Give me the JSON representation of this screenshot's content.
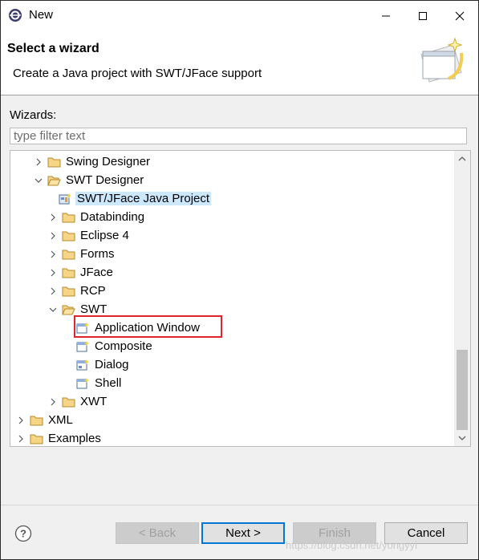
{
  "window": {
    "title": "New"
  },
  "banner": {
    "title": "Select a wizard",
    "description": "Create a Java project with SWT/JFace support"
  },
  "wizards": {
    "label": "Wizards:",
    "filter_placeholder": "type filter text"
  },
  "tree": {
    "items": [
      {
        "label": "Swing Designer",
        "depth": 1,
        "expander": "collapsed",
        "icon": "folder-icon"
      },
      {
        "label": "SWT Designer",
        "depth": 1,
        "expander": "expanded",
        "icon": "folder-open-icon"
      },
      {
        "label": "SWT/JFace Java Project",
        "depth": 2,
        "expander": "none",
        "icon": "java-project-icon",
        "selected": true
      },
      {
        "label": "Databinding",
        "depth": 2,
        "expander": "collapsed",
        "icon": "folder-icon"
      },
      {
        "label": "Eclipse 4",
        "depth": 2,
        "expander": "collapsed",
        "icon": "folder-icon"
      },
      {
        "label": "Forms",
        "depth": 2,
        "expander": "collapsed",
        "icon": "folder-icon"
      },
      {
        "label": "JFace",
        "depth": 2,
        "expander": "collapsed",
        "icon": "folder-icon"
      },
      {
        "label": "RCP",
        "depth": 2,
        "expander": "collapsed",
        "icon": "folder-icon"
      },
      {
        "label": "SWT",
        "depth": 2,
        "expander": "expanded",
        "icon": "folder-open-icon"
      },
      {
        "label": "Application Window",
        "depth": 3,
        "expander": "none",
        "icon": "window-wizard-icon"
      },
      {
        "label": "Composite",
        "depth": 3,
        "expander": "none",
        "icon": "window-wizard-icon"
      },
      {
        "label": "Dialog",
        "depth": 3,
        "expander": "none",
        "icon": "dialog-wizard-icon"
      },
      {
        "label": "Shell",
        "depth": 3,
        "expander": "none",
        "icon": "window-wizard-icon"
      },
      {
        "label": "XWT",
        "depth": 2,
        "expander": "collapsed",
        "icon": "folder-icon"
      },
      {
        "label": "XML",
        "depth": 0,
        "expander": "collapsed",
        "icon": "folder-icon"
      },
      {
        "label": "Examples",
        "depth": 0,
        "expander": "collapsed",
        "icon": "folder-icon"
      }
    ]
  },
  "buttons": {
    "back": "< Back",
    "next": "Next >",
    "finish": "Finish",
    "cancel": "Cancel"
  },
  "watermark": "https://blog.csdn.net/yongyyi",
  "colors": {
    "selection": "#cce8ff",
    "highlight_box": "#e0242c",
    "default_button_border": "#0078d7"
  }
}
